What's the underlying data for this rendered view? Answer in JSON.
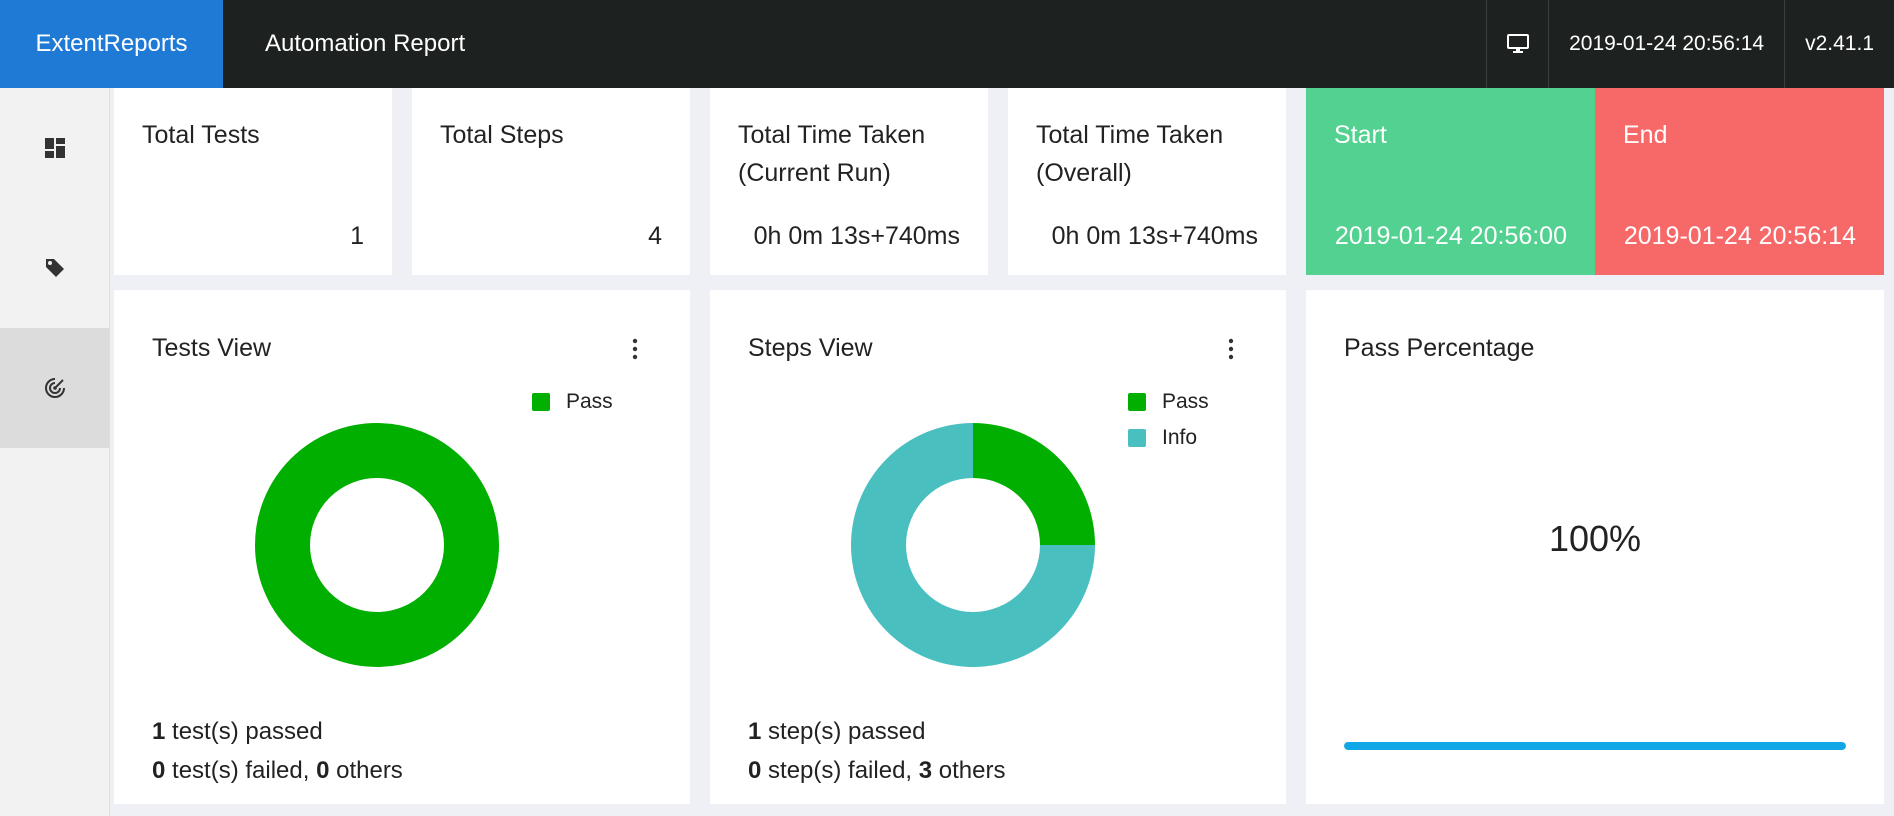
{
  "header": {
    "brand": "ExtentReports",
    "title": "Automation Report",
    "monitor_icon": "monitor-icon",
    "datetime": "2019-01-24 20:56:14",
    "version": "v2.41.1"
  },
  "sidebar": {
    "items": [
      {
        "icon": "dashboard-icon",
        "active": false
      },
      {
        "icon": "tag-icon",
        "active": false
      },
      {
        "icon": "radar-icon",
        "active": true
      }
    ]
  },
  "stats": {
    "total_tests": {
      "label": "Total Tests",
      "value": "1"
    },
    "total_steps": {
      "label": "Total Steps",
      "value": "4"
    },
    "time_current": {
      "label_line1": "Total Time Taken",
      "label_line2": "(Current Run)",
      "value": "0h 0m 13s+740ms"
    },
    "time_overall": {
      "label_line1": "Total Time Taken",
      "label_line2": "(Overall)",
      "value": "0h 0m 13s+740ms"
    },
    "start": {
      "label": "Start",
      "value": "2019-01-24 20:56:00",
      "color": "#52d191"
    },
    "end": {
      "label": "End",
      "value": "2019-01-24 20:56:14",
      "color": "#f76969"
    }
  },
  "tests_view": {
    "title": "Tests View",
    "legend": [
      {
        "name": "Pass",
        "color": "#00af00"
      }
    ],
    "summary": {
      "passed_count": "1",
      "passed_text": " test(s) passed",
      "failed_count": "0",
      "failed_text": " test(s) failed, ",
      "others_count": "0",
      "others_text": " others"
    }
  },
  "steps_view": {
    "title": "Steps View",
    "legend": [
      {
        "name": "Pass",
        "color": "#00af00"
      },
      {
        "name": "Info",
        "color": "#4abfc0"
      }
    ],
    "summary": {
      "passed_count": "1",
      "passed_text": " step(s) passed",
      "failed_count": "0",
      "failed_text": " step(s) failed, ",
      "others_count": "3",
      "others_text": " others"
    }
  },
  "pass_percentage": {
    "title": "Pass Percentage",
    "value_text": "100%",
    "value": 1.0,
    "bar_color": "#11a7e6"
  },
  "chart_data": [
    {
      "type": "pie",
      "title": "Tests View",
      "categories": [
        "Pass"
      ],
      "values": [
        1
      ],
      "colors": [
        "#00af00"
      ]
    },
    {
      "type": "pie",
      "title": "Steps View",
      "categories": [
        "Pass",
        "Info"
      ],
      "values": [
        1,
        3
      ],
      "colors": [
        "#00af00",
        "#4abfc0"
      ]
    }
  ]
}
